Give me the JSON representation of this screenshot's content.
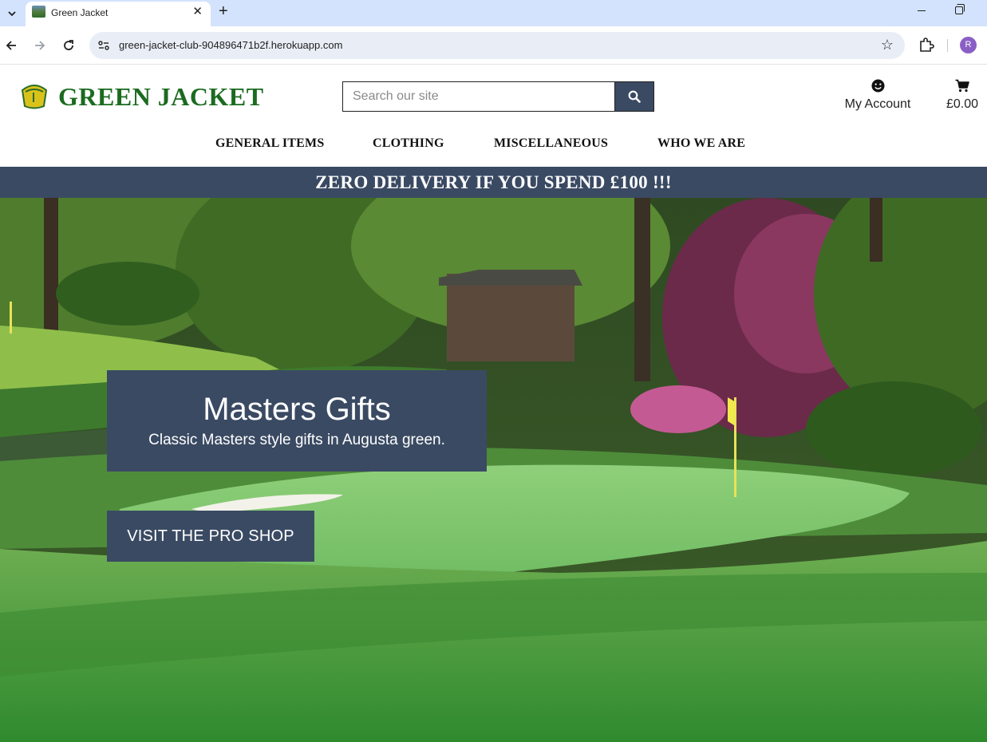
{
  "browser": {
    "tab_title": "Green Jacket",
    "url": "green-jacket-club-904896471b2f.herokuapp.com",
    "profile_initial": "R"
  },
  "site": {
    "brand": "GREEN JACKET",
    "search": {
      "placeholder": "Search our site"
    },
    "account_label": "My Account",
    "cart_total": "£0.00",
    "nav": [
      {
        "label": "GENERAL ITEMS"
      },
      {
        "label": "CLOTHING"
      },
      {
        "label": "MISCELLANEOUS"
      },
      {
        "label": "WHO WE ARE"
      }
    ],
    "banner": "ZERO DELIVERY IF YOU SPEND £100 !!!",
    "hero": {
      "title": "Masters Gifts",
      "subtitle": "Classic Masters style gifts in Augusta green.",
      "cta": "VISIT THE PRO SHOP"
    }
  },
  "colors": {
    "brand_green": "#1b6b1f",
    "navy": "#3a4a63",
    "chrome_tab_bar": "#d3e3fd"
  },
  "icons": [
    "chevron-down-icon",
    "close-icon",
    "plus-icon",
    "back-arrow-icon",
    "forward-arrow-icon",
    "reload-icon",
    "site-info-icon",
    "star-icon",
    "extensions-icon",
    "search-icon",
    "smiley-icon",
    "cart-icon"
  ]
}
